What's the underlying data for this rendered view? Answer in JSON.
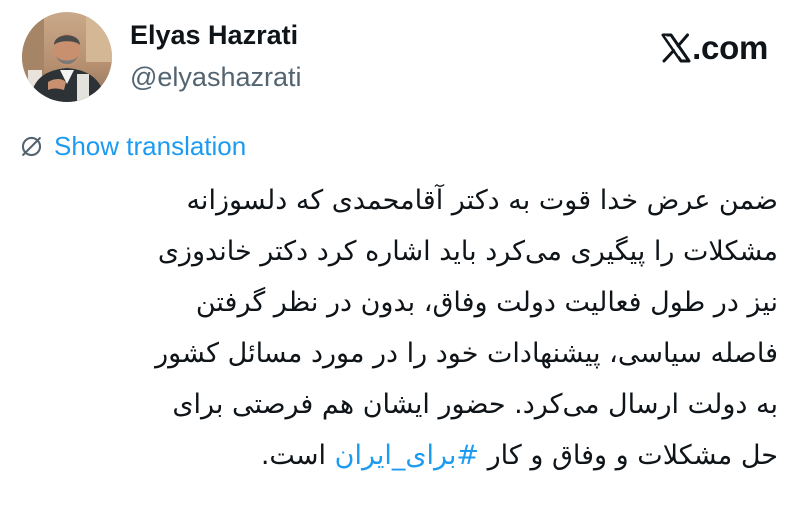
{
  "brand": {
    "logo_icon": "x-logo-icon",
    "label": ".com"
  },
  "author": {
    "name": "Elyas Hazrati",
    "handle": "@elyashazrati",
    "avatar_icon": "avatar-photo"
  },
  "translate": {
    "icon": "globe-slash-icon",
    "label": "Show translation"
  },
  "tweet": {
    "line1": "ضمن عرض خدا قوت به دکتر آقامحمدی که دلسوزانه",
    "line2": "مشکلات را پیگیری می‌کرد باید اشاره کرد دکتر خاندوزی",
    "line3": "نیز در طول فعالیت دولت وفاق، بدون در نظر گرفتن",
    "line4": "فاصله سیاسی، پیشنهادات خود را در مورد مسائل کشور",
    "line5": "به دولت ارسال می‌کرد. حضور ایشان هم فرصتی برای",
    "line6_start": "حل مشکلات و وفاق و کار ",
    "hashtag": "#برای_ایران",
    "line6_end": " است."
  },
  "colors": {
    "text": "#0f1419",
    "secondary": "#536471",
    "link": "#1d9bf0",
    "background": "#ffffff"
  }
}
